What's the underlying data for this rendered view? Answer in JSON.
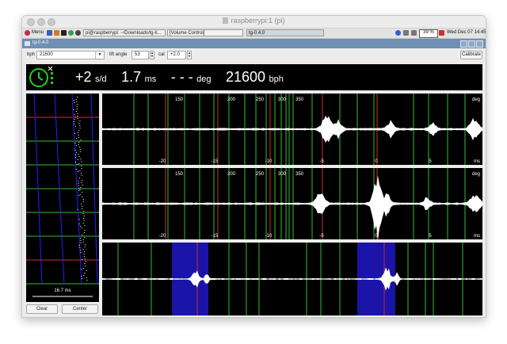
{
  "mac_window": {
    "title": "raspberrypi:1 (pi)"
  },
  "taskbar": {
    "menu_label": "Menu",
    "tasks": [
      "pi@raspberrypi: ~/Downloads/tg-ti...",
      "[Volume Control]",
      "tg-0.4.0"
    ],
    "battery": "39 %",
    "clock": "Wed Dec 07 14:45"
  },
  "app": {
    "title": "tg-0.4.0",
    "toolbar": {
      "bph_label": "bph",
      "bph_value": "21600",
      "lift_label": "lift angle",
      "lift_value": "53",
      "cal_label": "cal",
      "cal_value": "+2.0",
      "calibrate_label": "Calibrate"
    },
    "readout": {
      "rate_value": "+2",
      "rate_unit": "s/d",
      "beat_error_value": "1.7",
      "beat_error_unit": "ms",
      "amplitude_value": "- - -",
      "amplitude_unit": "deg",
      "bph_value": "21600",
      "bph_unit": "bph"
    },
    "left_panel": {
      "scale_label": "16.7 ms"
    },
    "buttons": {
      "clear_label": "Clear",
      "center_label": "Center"
    },
    "waveforms": {
      "deg_ticks": [
        "150",
        "200",
        "250",
        "300",
        "350"
      ],
      "ms_ticks": [
        "-20",
        "-15",
        "-10",
        "-5",
        "0",
        "5"
      ],
      "deg_unit": "deg",
      "ms_unit": "ms"
    }
  },
  "colors": {
    "grid_green": "#2fbf2f",
    "marker_red": "#d82a2a",
    "trace_blue": "#2222ff",
    "highlight_blue": "#1a14a8",
    "signal_white": "#ffffff",
    "clock_green": "#22d022",
    "title_blue": "#6f8fb3"
  }
}
